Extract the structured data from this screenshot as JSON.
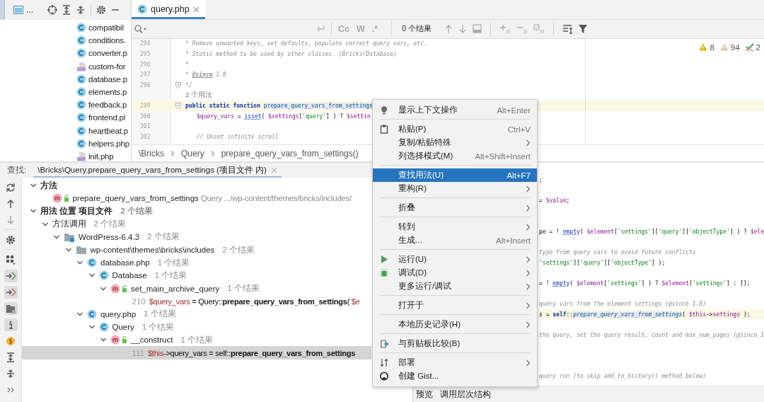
{
  "project": {
    "toolbar": {
      "view_label": "..."
    },
    "files": [
      {
        "kind": "class",
        "name": "compatibil"
      },
      {
        "kind": "class",
        "name": "conditions."
      },
      {
        "kind": "class",
        "name": "converter.p"
      },
      {
        "kind": "php",
        "name": "custom-for"
      },
      {
        "kind": "class",
        "name": "database.p"
      },
      {
        "kind": "class",
        "name": "elements.p"
      },
      {
        "kind": "class",
        "name": "feedback.p"
      },
      {
        "kind": "class",
        "name": "frontend.pl"
      },
      {
        "kind": "class",
        "name": "heartbeat.p"
      },
      {
        "kind": "class",
        "name": "helpers.php"
      },
      {
        "kind": "php",
        "name": "init.php"
      }
    ]
  },
  "editor": {
    "tabs": [
      {
        "label": "query.php",
        "selected": true
      }
    ],
    "search": {
      "options": [
        "Cc",
        "W",
        ".*"
      ],
      "results": "0 个结果"
    },
    "inspections": [
      {
        "kind": "warning",
        "count": "8"
      },
      {
        "kind": "weak",
        "count": "94"
      },
      {
        "kind": "typo",
        "count": "2"
      }
    ],
    "lines": [
      {
        "number": "294",
        "segments": [
          {
            "kind": "comment",
            "t": "* Remove unwanted keys, set defaults, populate correct query vars, etc."
          }
        ]
      },
      {
        "number": "295",
        "segments": [
          {
            "kind": "comment",
            "t": "* Static method to be used by other classes. (Bricks\\Database)"
          }
        ]
      },
      {
        "number": "296",
        "segments": [
          {
            "kind": "comment",
            "t": "*"
          }
        ]
      },
      {
        "number": "297",
        "segments": [
          {
            "kind": "comment",
            "t": "* "
          },
          {
            "kind": "doc",
            "t": "@since"
          },
          {
            "kind": "comment",
            "t": " 1.8"
          }
        ]
      },
      {
        "number": "298",
        "fold": true,
        "segments": [
          {
            "kind": "comment",
            "t": "*/"
          }
        ]
      },
      {
        "kind": "inlay",
        "text": "2 个用法"
      },
      {
        "number": "299",
        "fold": true,
        "highlighted": true,
        "segments": [
          {
            "kind": "keyword",
            "t": "public static function "
          },
          {
            "kind": "decl",
            "t": "prepare_query_vars_from_settings"
          }
        ]
      },
      {
        "number": "300",
        "indented": true,
        "segments": [
          {
            "kind": "var",
            "t": "$query_vars"
          },
          {
            "kind": "plain",
            "t": " = "
          },
          {
            "kind": "call",
            "t": "isset"
          },
          {
            "kind": "plain",
            "t": "( "
          },
          {
            "kind": "var",
            "t": "$settings"
          },
          {
            "kind": "plain",
            "t": "["
          },
          {
            "kind": "string",
            "t": "'query'"
          },
          {
            "kind": "plain",
            "t": "] ) ? "
          },
          {
            "kind": "var",
            "t": "$settin"
          }
        ]
      },
      {
        "number": "301"
      },
      {
        "number": "302",
        "indented": true,
        "segments": [
          {
            "kind": "comment",
            "t": "// Unset infinite scroll"
          }
        ]
      }
    ],
    "breadcrumb": [
      "\\Bricks",
      "Query",
      "prepare_query_vars_from_settings()"
    ]
  },
  "find": {
    "label": "查找:",
    "tab": {
      "label": "\\Bricks\\Query.prepare_query_vars_from_settings (项目文件 内)",
      "selected": true
    },
    "tree": [
      {
        "kind": "group",
        "label": "方法",
        "expanded": true,
        "children": [
          {
            "kind": "method",
            "label": "prepare_query_vars_from_settings",
            "detail": "Query .../wp-content/themes/bricks/includes/"
          }
        ]
      },
      {
        "kind": "group",
        "label": "用法 位置 项目文件",
        "count": "2 个结果",
        "expanded": true,
        "children": [
          {
            "kind": "category",
            "label": "方法调用",
            "count": "2 个结果",
            "expanded": true,
            "children": [
              {
                "kind": "module",
                "label": "WordPress-6.4.3",
                "count": "2 个结果",
                "expanded": true,
                "children": [
                  {
                    "kind": "folder",
                    "label": "wp-content\\themes\\bricks\\includes",
                    "count": "2 个结果",
                    "expanded": true,
                    "children": [
                      {
                        "kind": "class",
                        "label": "database.php",
                        "count": "1 个结果",
                        "expanded": true,
                        "children": [
                          {
                            "kind": "class",
                            "label": "Database",
                            "count": "1 个结果",
                            "expanded": true,
                            "children": [
                              {
                                "kind": "method",
                                "label": "set_main_archive_query",
                                "count": "1 个结果",
                                "expanded": true,
                                "children": [
                                  {
                                    "kind": "usage",
                                    "line": "210",
                                    "selected": false,
                                    "segments": [
                                      {
                                        "kind": "var",
                                        "t": "$query_vars"
                                      },
                                      {
                                        "kind": "plain",
                                        "t": " = Query::"
                                      },
                                      {
                                        "kind": "bold",
                                        "t": "prepare_query_vars_from_settings"
                                      },
                                      {
                                        "kind": "plain",
                                        "t": "( "
                                      },
                                      {
                                        "kind": "var",
                                        "t": "$e"
                                      }
                                    ]
                                  }
                                ]
                              }
                            ]
                          }
                        ]
                      },
                      {
                        "kind": "class",
                        "label": "query.php",
                        "count": "1 个结果",
                        "expanded": true,
                        "children": [
                          {
                            "kind": "class",
                            "label": "Query",
                            "count": "1 个结果",
                            "expanded": true,
                            "children": [
                              {
                                "kind": "method",
                                "label": "__construct",
                                "count": "1 个结果",
                                "expanded": true,
                                "children": [
                                  {
                                    "kind": "usage",
                                    "line": "111",
                                    "selected": true,
                                    "segments": [
                                      {
                                        "kind": "var",
                                        "t": "$this"
                                      },
                                      {
                                        "kind": "plain",
                                        "t": "->query_vars = self::"
                                      },
                                      {
                                        "kind": "bold",
                                        "t": "prepare_query_vars_from_settings"
                                      }
                                    ]
                                  }
                                ]
                              }
                            ]
                          }
                        ]
                      }
                    ]
                  }
                ]
              }
            ]
          }
        ]
      }
    ]
  },
  "preview": {
    "lines": [
      {
        "segments": [
          {
            "kind": "plain",
            "t": ";"
          }
        ]
      },
      {
        "segments": [
          {
            "kind": "plain",
            "t": "= "
          },
          {
            "kind": "var",
            "t": "$value"
          },
          {
            "kind": "plain",
            "t": ";"
          }
        ]
      },
      {
        "segments": [
          {
            "kind": "plain",
            "t": "pe = ! "
          },
          {
            "kind": "call",
            "t": "empty"
          },
          {
            "kind": "plain",
            "t": "( "
          },
          {
            "kind": "var",
            "t": "$element"
          },
          {
            "kind": "plain",
            "t": "["
          },
          {
            "kind": "string",
            "t": "'settings'"
          },
          {
            "kind": "plain",
            "t": "]["
          },
          {
            "kind": "string",
            "t": "'query'"
          },
          {
            "kind": "plain",
            "t": "]["
          },
          {
            "kind": "string",
            "t": "'objectType'"
          },
          {
            "kind": "plain",
            "t": "] ) ? "
          },
          {
            "kind": "var",
            "t": "$ele"
          }
        ]
      },
      {
        "segments": [
          {
            "kind": "comment",
            "t": "type from query vars to avoid future conflicts"
          }
        ]
      },
      {
        "segments": [
          {
            "kind": "string",
            "t": "'settings'"
          },
          {
            "kind": "plain",
            "t": "]["
          },
          {
            "kind": "string",
            "t": "'query'"
          },
          {
            "kind": "plain",
            "t": "]["
          },
          {
            "kind": "string",
            "t": "'objectType'"
          },
          {
            "kind": "plain",
            "t": "] );"
          }
        ]
      },
      {
        "segments": [
          {
            "kind": "plain",
            "t": "= ! "
          },
          {
            "kind": "call",
            "t": "empty"
          },
          {
            "kind": "plain",
            "t": "( "
          },
          {
            "kind": "var",
            "t": "$element"
          },
          {
            "kind": "plain",
            "t": "["
          },
          {
            "kind": "string",
            "t": "'settings'"
          },
          {
            "kind": "plain",
            "t": "] ) ? "
          },
          {
            "kind": "var",
            "t": "$element"
          },
          {
            "kind": "plain",
            "t": "["
          },
          {
            "kind": "string",
            "t": "'settings'"
          },
          {
            "kind": "plain",
            "t": "] : [];"
          }
        ]
      },
      {
        "segments": [
          {
            "kind": "comment",
            "t": "query vars from the element settings (@since 1.8)"
          }
        ]
      },
      {
        "highlighted": true,
        "segments": [
          {
            "kind": "plain",
            "t": "s = "
          },
          {
            "kind": "keyword",
            "t": "self"
          },
          {
            "kind": "plain",
            "t": "::"
          },
          {
            "kind": "decl",
            "t": "prepare_query_vars_from_settings"
          },
          {
            "kind": "plain",
            "t": "( "
          },
          {
            "kind": "var",
            "t": "$this"
          },
          {
            "kind": "plain",
            "t": "->"
          },
          {
            "kind": "field",
            "t": "settings"
          },
          {
            "kind": "plain",
            "t": " );"
          }
        ]
      },
      {
        "segments": [
          {
            "kind": "comment",
            "t": "the query, set the query result, count and max_num_pages (@since 1"
          }
        ]
      },
      {
        "segments": [
          {
            "kind": "comment",
            "t": "query run (to skip add_to_history() method below)"
          }
        ]
      }
    ],
    "tabs": [
      "预览",
      "调用层次结构"
    ]
  },
  "menu": [
    {
      "kind": "item",
      "label": "显示上下文操作",
      "shortcut": "Alt+Enter",
      "selected": false
    },
    {
      "kind": "separator"
    },
    {
      "kind": "item",
      "label": "粘贴(P)",
      "shortcut": "Ctrl+V",
      "selected": false
    },
    {
      "kind": "item",
      "label": "复制/粘贴特殊",
      "submenu": true,
      "selected": false
    },
    {
      "kind": "item",
      "label": "列选择模式(M)",
      "shortcut": "Alt+Shift+Insert",
      "selected": false
    },
    {
      "kind": "separator"
    },
    {
      "kind": "item",
      "label": "查找用法(U)",
      "shortcut": "Alt+F7",
      "selected": true
    },
    {
      "kind": "item",
      "label": "重构(R)",
      "submenu": true,
      "selected": false
    },
    {
      "kind": "separator"
    },
    {
      "kind": "item",
      "label": "折叠",
      "submenu": true,
      "selected": false
    },
    {
      "kind": "separator"
    },
    {
      "kind": "item",
      "label": "转到",
      "submenu": true,
      "selected": false
    },
    {
      "kind": "item",
      "label": "生成...",
      "shortcut": "Alt+Insert",
      "selected": false
    },
    {
      "kind": "separator"
    },
    {
      "kind": "item",
      "label": "运行(U)",
      "submenu": true,
      "selected": false
    },
    {
      "kind": "item",
      "label": "调试(D)",
      "submenu": true,
      "selected": false
    },
    {
      "kind": "item",
      "label": "更多运行/调试",
      "submenu": true,
      "selected": false
    },
    {
      "kind": "separator"
    },
    {
      "kind": "item",
      "label": "打开于",
      "submenu": true,
      "selected": false
    },
    {
      "kind": "separator"
    },
    {
      "kind": "item",
      "label": "本地历史记录(H)",
      "submenu": true,
      "selected": false
    },
    {
      "kind": "separator"
    },
    {
      "kind": "item",
      "label": "与剪贴板比较(B)",
      "selected": false
    },
    {
      "kind": "separator"
    },
    {
      "kind": "item",
      "label": "部署",
      "submenu": true,
      "selected": false
    },
    {
      "kind": "item",
      "label": "创建 Gist...",
      "selected": false
    }
  ]
}
